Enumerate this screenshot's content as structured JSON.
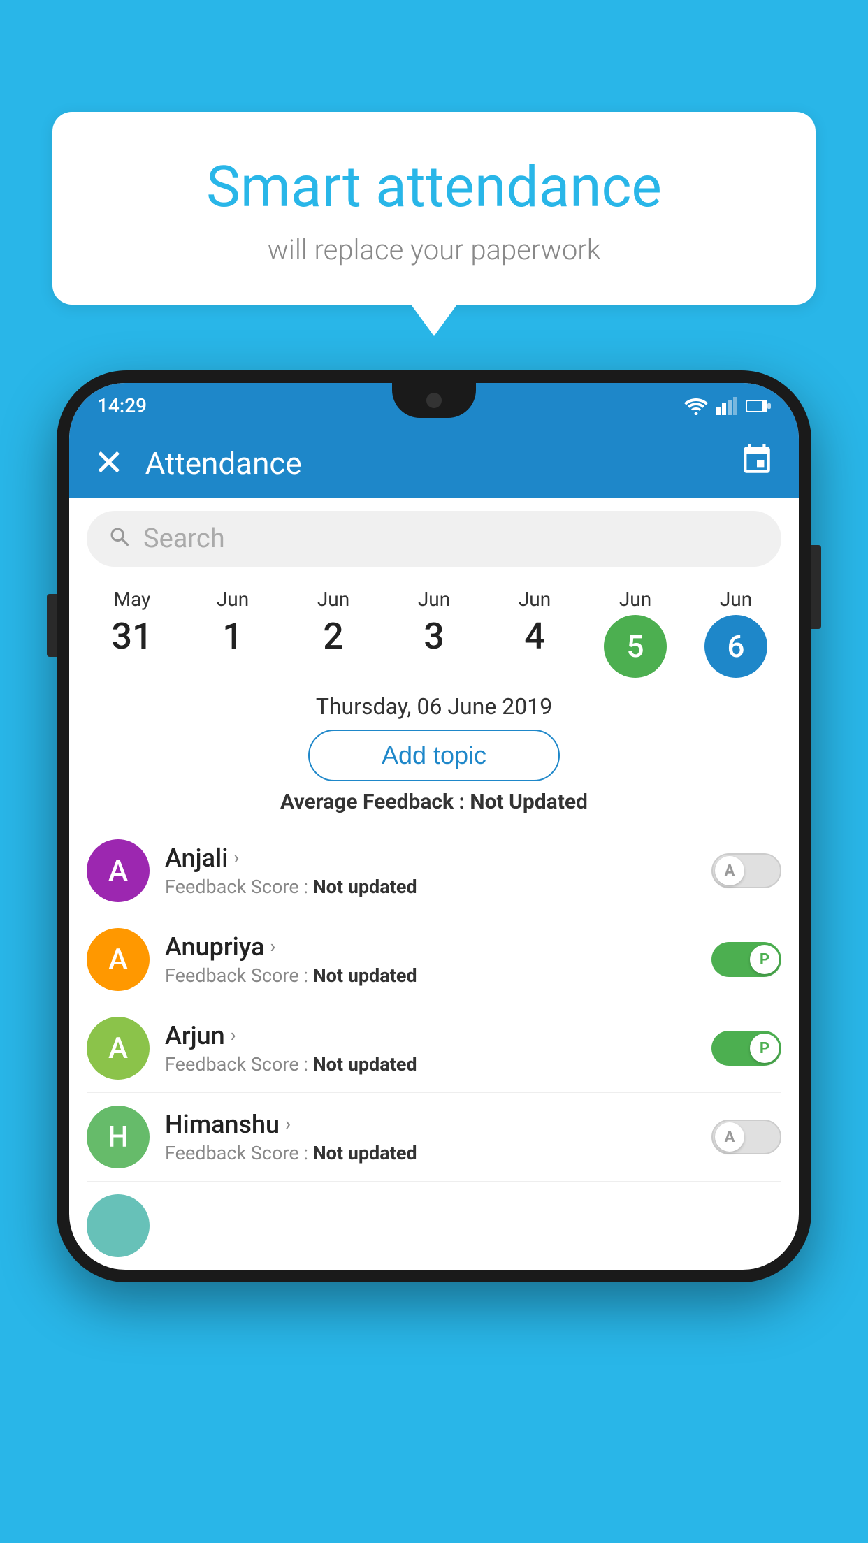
{
  "background_color": "#29b6e8",
  "bubble": {
    "title": "Smart attendance",
    "subtitle": "will replace your paperwork"
  },
  "status_bar": {
    "time": "14:29"
  },
  "app_bar": {
    "title": "Attendance"
  },
  "search": {
    "placeholder": "Search"
  },
  "dates": [
    {
      "month": "May",
      "day": "31",
      "state": "normal"
    },
    {
      "month": "Jun",
      "day": "1",
      "state": "normal"
    },
    {
      "month": "Jun",
      "day": "2",
      "state": "normal"
    },
    {
      "month": "Jun",
      "day": "3",
      "state": "normal"
    },
    {
      "month": "Jun",
      "day": "4",
      "state": "normal"
    },
    {
      "month": "Jun",
      "day": "5",
      "state": "green"
    },
    {
      "month": "Jun",
      "day": "6",
      "state": "blue"
    }
  ],
  "selected_date_label": "Thursday, 06 June 2019",
  "add_topic_label": "Add topic",
  "average_feedback": {
    "label": "Average Feedback : ",
    "value": "Not Updated"
  },
  "students": [
    {
      "name": "Anjali",
      "avatar_letter": "A",
      "avatar_color": "purple",
      "feedback_label": "Feedback Score : ",
      "feedback_value": "Not updated",
      "toggle_state": "off",
      "toggle_label": "A"
    },
    {
      "name": "Anupriya",
      "avatar_letter": "A",
      "avatar_color": "orange",
      "feedback_label": "Feedback Score : ",
      "feedback_value": "Not updated",
      "toggle_state": "on",
      "toggle_label": "P"
    },
    {
      "name": "Arjun",
      "avatar_letter": "A",
      "avatar_color": "lightgreen",
      "feedback_label": "Feedback Score : ",
      "feedback_value": "Not updated",
      "toggle_state": "on",
      "toggle_label": "P"
    },
    {
      "name": "Himanshu",
      "avatar_letter": "H",
      "avatar_color": "green2",
      "feedback_label": "Feedback Score : ",
      "feedback_value": "Not updated",
      "toggle_state": "off",
      "toggle_label": "A"
    }
  ]
}
